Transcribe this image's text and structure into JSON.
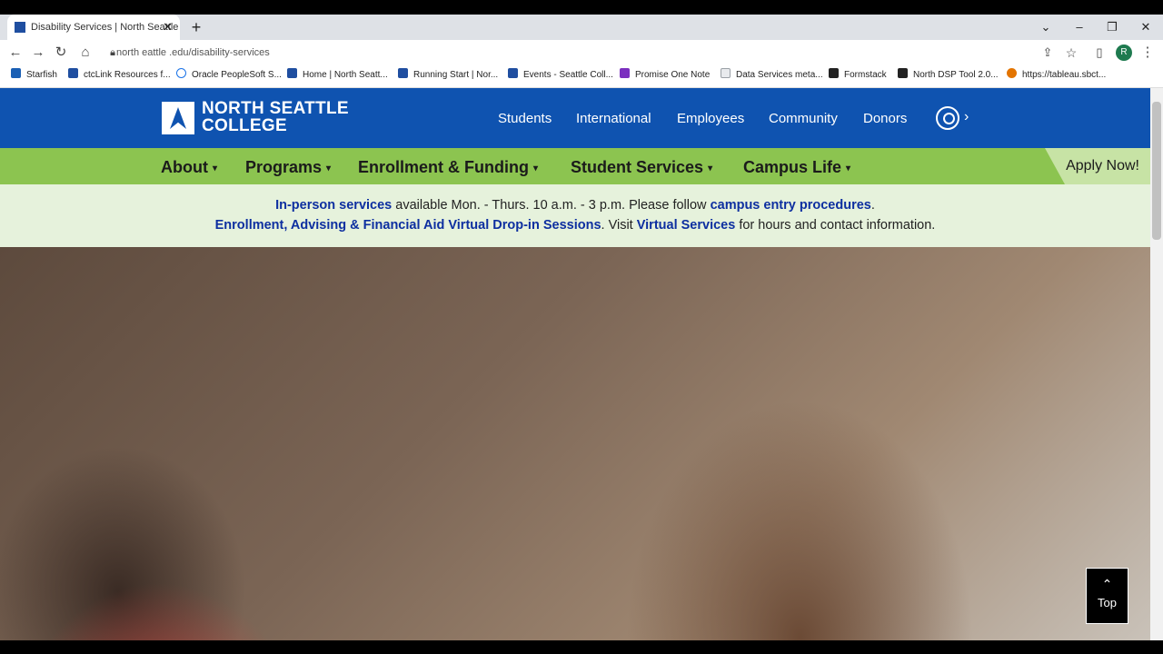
{
  "browser": {
    "tab_title": "Disability Services | North Seattle",
    "tab_close": "✕",
    "new_tab": "+",
    "url": "north  eattle  .edu/disability-services",
    "profile_initial": "R",
    "bookmarks": [
      {
        "label": "Starfish",
        "color": "#1a5fb4"
      },
      {
        "label": "ctcLink Resources f...",
        "color": "#1f4ea0"
      },
      {
        "label": "Oracle PeopleSoft S...",
        "color": "#1a73e8"
      },
      {
        "label": "Home | North Seatt...",
        "color": "#1f4ea0"
      },
      {
        "label": "Running Start | Nor...",
        "color": "#1f4ea0"
      },
      {
        "label": "Events - Seattle Coll...",
        "color": "#1f4ea0"
      },
      {
        "label": "Promise One Note",
        "color": "#7b2fbf"
      },
      {
        "label": "Data Services meta...",
        "color": "#9aa0a6"
      },
      {
        "label": "Formstack",
        "color": "#222222"
      },
      {
        "label": "North DSP Tool 2.0...",
        "color": "#222222"
      },
      {
        "label": "https://tableau.sbct...",
        "color": "#e37400"
      }
    ]
  },
  "site": {
    "logo_line1": "NORTH SEATTLE",
    "logo_line2": "COLLEGE",
    "top_nav": [
      "Students",
      "International",
      "Employees",
      "Community",
      "Donors"
    ],
    "main_nav": [
      "About",
      "Programs",
      "Enrollment & Funding",
      "Student Services",
      "Campus Life"
    ],
    "caret": "▾",
    "apply": "Apply Now!",
    "search_chevron": "›",
    "alert": {
      "l1_link1": "In-person services",
      "l1_text1": " available Mon. - Thurs. 10 a.m. - 3 p.m. Please follow ",
      "l1_link2": "campus entry procedures",
      "l1_text2": ".",
      "l2_link1": "Enrollment, Advising & Financial Aid Virtual Drop-in Sessions",
      "l2_text1": ". Visit ",
      "l2_link2": "Virtual Services",
      "l2_text2": " for hours and contact information."
    },
    "top_button": "Top",
    "top_arrow": "⌃"
  },
  "colors": {
    "header_blue": "#0f53b0",
    "nav_green": "#8cc450",
    "alert_bg": "#e6f2dc",
    "link_blue": "#0d2fa0"
  }
}
